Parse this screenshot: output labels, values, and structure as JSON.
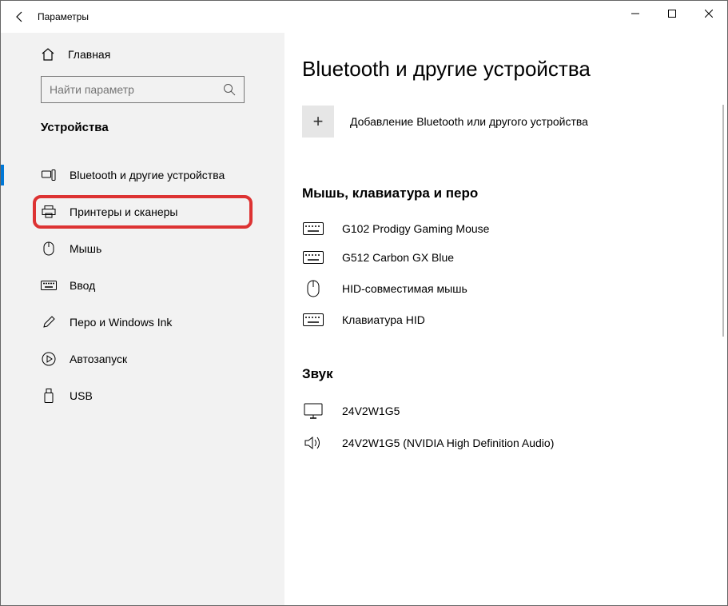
{
  "window": {
    "title": "Параметры"
  },
  "home": {
    "label": "Главная"
  },
  "search": {
    "placeholder": "Найти параметр"
  },
  "section": {
    "title": "Устройства"
  },
  "nav": {
    "bluetooth": "Bluetooth и другие устройства",
    "printers": "Принтеры и сканеры",
    "mouse": "Мышь",
    "input": "Ввод",
    "pen": "Перо и Windows Ink",
    "autoplay": "Автозапуск",
    "usb": "USB"
  },
  "main": {
    "heading": "Bluetooth и другие устройства",
    "add_label": "Добавление Bluetooth или другого устройства",
    "group1_title": "Мышь, клавиатура и перо",
    "dev1": "G102 Prodigy Gaming Mouse",
    "dev2": "G512 Carbon GX Blue",
    "dev3": "HID-совместимая мышь",
    "dev4": "Клавиатура HID",
    "group2_title": "Звук",
    "dev5": "24V2W1G5",
    "dev6": "24V2W1G5 (NVIDIA High Definition Audio)"
  }
}
